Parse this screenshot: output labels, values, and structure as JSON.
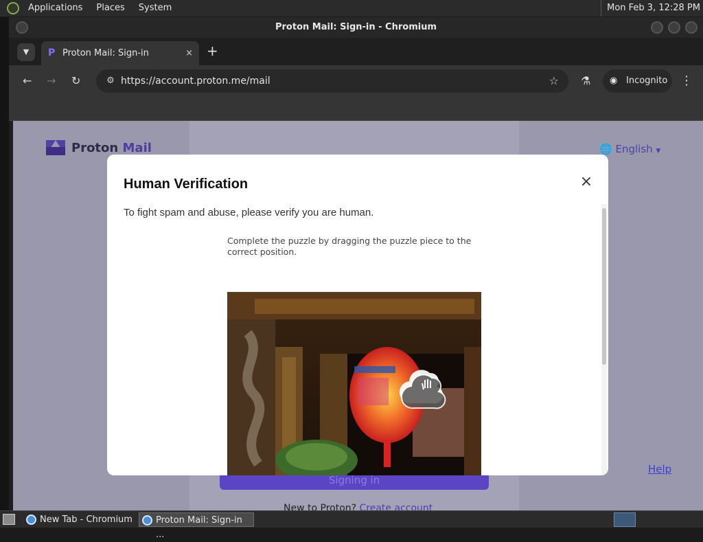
{
  "top_panel": {
    "menus": [
      "Applications",
      "Places",
      "System"
    ],
    "clock": "Mon Feb  3, 12:28 PM"
  },
  "window": {
    "title": "Proton Mail: Sign-in - Chromium"
  },
  "browser": {
    "tab": {
      "title": "Proton Mail: Sign-in",
      "close": "×",
      "favicon": "proton-icon"
    },
    "new_tab": "+",
    "url": "https://account.proton.me/mail",
    "incognito_label": "Incognito"
  },
  "page": {
    "logo_text_1": "Proton",
    "logo_text_2": "Mail",
    "language": "English",
    "signin_button": "Signing in",
    "help_link": "Help",
    "new_to_proton": "New to Proton?",
    "create_account": "Create account"
  },
  "modal": {
    "title": "Human Verification",
    "close": "×",
    "description": "To fight spam and abuse, please verify you are human.",
    "captcha_instructions": "Complete the puzzle by dragging the puzzle piece to the correct position."
  },
  "taskbar": {
    "tasks": [
      "New Tab - Chromium",
      "Proton Mail: Sign-in ..."
    ]
  },
  "colors": {
    "brand": "#6d4aff",
    "overlay": "#9a98ad",
    "modal_bg": "#ffffff"
  }
}
